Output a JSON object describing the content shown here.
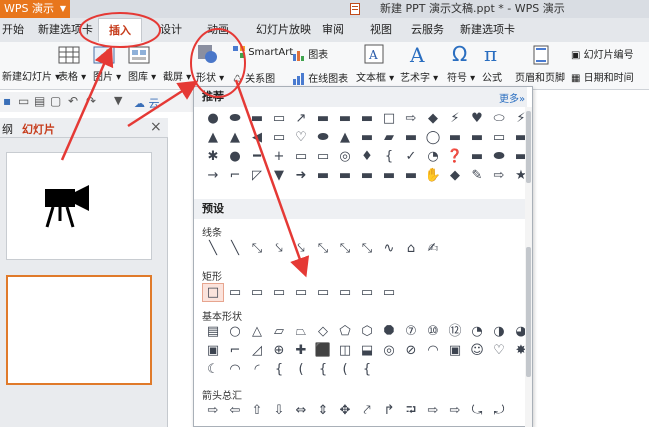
{
  "app": {
    "name": "WPS 演示",
    "doc_title": "新建 PPT 演示文稿.ppt * - WPS 演示"
  },
  "tabs": [
    "开始",
    "新建选项卡",
    "插入",
    "设计",
    "动画",
    "幻灯片放映",
    "审阅",
    "视图",
    "云服务",
    "新建选项卡"
  ],
  "active_tab": "插入",
  "ribbon": {
    "new_slide": "新建幻灯片",
    "table": "表格",
    "picture": "图片",
    "gallery": "图库",
    "screenshot": "截屏",
    "shapes": "形状",
    "smartart": "SmartArt",
    "chart": "图表",
    "relation": "关系图",
    "online_chart": "在线图表",
    "textbox": "文本框",
    "wordart": "艺术字",
    "symbol": "符号",
    "formula": "公式",
    "header_footer": "页眉和页脚",
    "slide_number": "幻灯片编号",
    "date_time": "日期和时间"
  },
  "qat": {
    "cloud": "云"
  },
  "left_panel": {
    "tab_outline": "纲",
    "tab_slides": "幻灯片",
    "close": "×"
  },
  "dropdown": {
    "recommended": "推荐",
    "more": "更多»",
    "preset": "预设",
    "lines": "线条",
    "rect": "矩形",
    "basic": "基本形状",
    "arrows": "箭头总汇"
  },
  "shapes": {
    "rec_row1": [
      "●",
      "⬬",
      "▬",
      "▭",
      "↗",
      "▬",
      "▬",
      "▬",
      "□",
      "⇨",
      "◆",
      "⚡",
      "♥",
      "⬭",
      "⚡"
    ],
    "rec_row2": [
      "▲",
      "▲",
      "◀",
      "▭",
      "♡",
      "⬬",
      "▲",
      "▬",
      "▰",
      "▬",
      "◯",
      "▬",
      "▬",
      "▭",
      "▬"
    ],
    "rec_row3": [
      "✱",
      "●",
      "━",
      "+",
      "▭",
      "▭",
      "◎",
      "♦",
      "{",
      "✓",
      "◔",
      "❓",
      "▬",
      "⬬",
      "▬"
    ],
    "rec_row4": [
      "→",
      "⌐",
      "◸",
      "▼",
      "➜",
      "▬",
      "▬",
      "▬",
      "▬",
      "▬",
      "✋",
      "◆",
      "✎",
      "⇨",
      "★"
    ],
    "lines": [
      "╲",
      "╲",
      "⤡",
      "⤥",
      "⤥",
      "⤡",
      "⤡",
      "⤡",
      "∿",
      "⌂",
      "✍"
    ],
    "rects": [
      "□",
      "▭",
      "▭",
      "▭",
      "▭",
      "▭",
      "▭",
      "▭",
      "▭"
    ],
    "basic_row1": [
      "▤",
      "○",
      "△",
      "▱",
      "⏢",
      "◇",
      "⬠",
      "⬡",
      "⯃",
      "⑦",
      "⑩",
      "⑫",
      "◔",
      "◑",
      "◕"
    ],
    "basic_row2": [
      "▣",
      "⌐",
      "◿",
      "⊕",
      "✚",
      "⬛",
      "◫",
      "⬓",
      "◎",
      "⊘",
      "◠",
      "▣",
      "☺",
      "♡",
      "✸"
    ],
    "basic_row3": [
      "☾",
      "◠",
      "◜",
      "{",
      "(",
      "{",
      "(",
      "{"
    ],
    "arrows_row": [
      "⇨",
      "⇦",
      "⇧",
      "⇩",
      "⇔",
      "⇕",
      "✥",
      "⤤",
      "↱",
      "⮒",
      "⇨",
      "⇨",
      "⤿",
      "⤾",
      "⤼",
      "⮔"
    ]
  },
  "colors": {
    "accent_orange": "#e8761c",
    "annotation_red": "#e53935",
    "shape_gray": "#3d4450"
  }
}
